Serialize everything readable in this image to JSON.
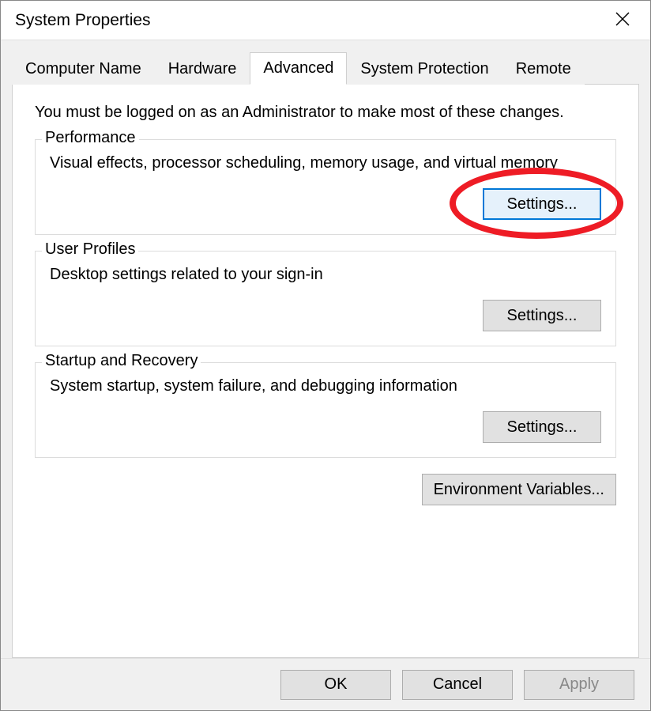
{
  "window": {
    "title": "System Properties"
  },
  "tabs": {
    "computer_name": "Computer Name",
    "hardware": "Hardware",
    "advanced": "Advanced",
    "system_protection": "System Protection",
    "remote": "Remote"
  },
  "advanced": {
    "intro": "You must be logged on as an Administrator to make most of these changes.",
    "performance": {
      "title": "Performance",
      "desc": "Visual effects, processor scheduling, memory usage, and virtual memory",
      "settings_label": "Settings..."
    },
    "user_profiles": {
      "title": "User Profiles",
      "desc": "Desktop settings related to your sign-in",
      "settings_label": "Settings..."
    },
    "startup_recovery": {
      "title": "Startup and Recovery",
      "desc": "System startup, system failure, and debugging information",
      "settings_label": "Settings..."
    },
    "env_vars_label": "Environment Variables..."
  },
  "footer": {
    "ok": "OK",
    "cancel": "Cancel",
    "apply": "Apply"
  }
}
